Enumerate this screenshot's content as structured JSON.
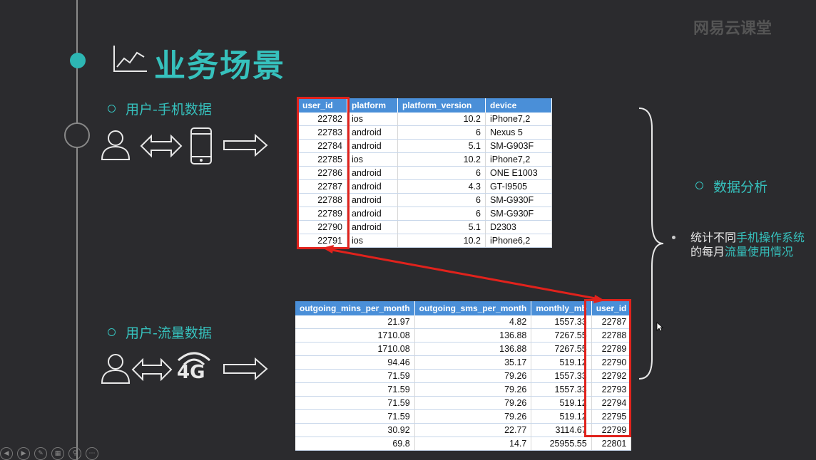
{
  "title": "业务场景",
  "logo": "网易云课堂",
  "sections": {
    "phone": "用户-手机数据",
    "traffic": "用户-流量数据",
    "analysis": "数据分析"
  },
  "description": {
    "p1": "统计不同",
    "h1": "手机操作系统",
    "p2": "的每月",
    "h2": "流量使用情况"
  },
  "network_label": "4G",
  "table1": {
    "headers": [
      "user_id",
      "platform",
      "platform_version",
      "device"
    ],
    "rows": [
      [
        "22782",
        "ios",
        "10.2",
        "iPhone7,2"
      ],
      [
        "22783",
        "android",
        "6",
        "Nexus 5"
      ],
      [
        "22784",
        "android",
        "5.1",
        "SM-G903F"
      ],
      [
        "22785",
        "ios",
        "10.2",
        "iPhone7,2"
      ],
      [
        "22786",
        "android",
        "6",
        "ONE E1003"
      ],
      [
        "22787",
        "android",
        "4.3",
        "GT-I9505"
      ],
      [
        "22788",
        "android",
        "6",
        "SM-G930F"
      ],
      [
        "22789",
        "android",
        "6",
        "SM-G930F"
      ],
      [
        "22790",
        "android",
        "5.1",
        "D2303"
      ],
      [
        "22791",
        "ios",
        "10.2",
        "iPhone6,2"
      ]
    ]
  },
  "table2": {
    "headers": [
      "outgoing_mins_per_month",
      "outgoing_sms_per_month",
      "monthly_mb",
      "user_id"
    ],
    "rows": [
      [
        "21.97",
        "4.82",
        "1557.33",
        "22787"
      ],
      [
        "1710.08",
        "136.88",
        "7267.55",
        "22788"
      ],
      [
        "1710.08",
        "136.88",
        "7267.55",
        "22789"
      ],
      [
        "94.46",
        "35.17",
        "519.12",
        "22790"
      ],
      [
        "71.59",
        "79.26",
        "1557.33",
        "22792"
      ],
      [
        "71.59",
        "79.26",
        "1557.33",
        "22793"
      ],
      [
        "71.59",
        "79.26",
        "519.12",
        "22794"
      ],
      [
        "71.59",
        "79.26",
        "519.12",
        "22795"
      ],
      [
        "30.92",
        "22.77",
        "3114.67",
        "22799"
      ],
      [
        "69.8",
        "14.7",
        "25955.55",
        "22801"
      ]
    ]
  },
  "colors": {
    "accent": "#36c1bd",
    "highlight_box": "#e0221c",
    "table_header": "#4a8fd8"
  }
}
